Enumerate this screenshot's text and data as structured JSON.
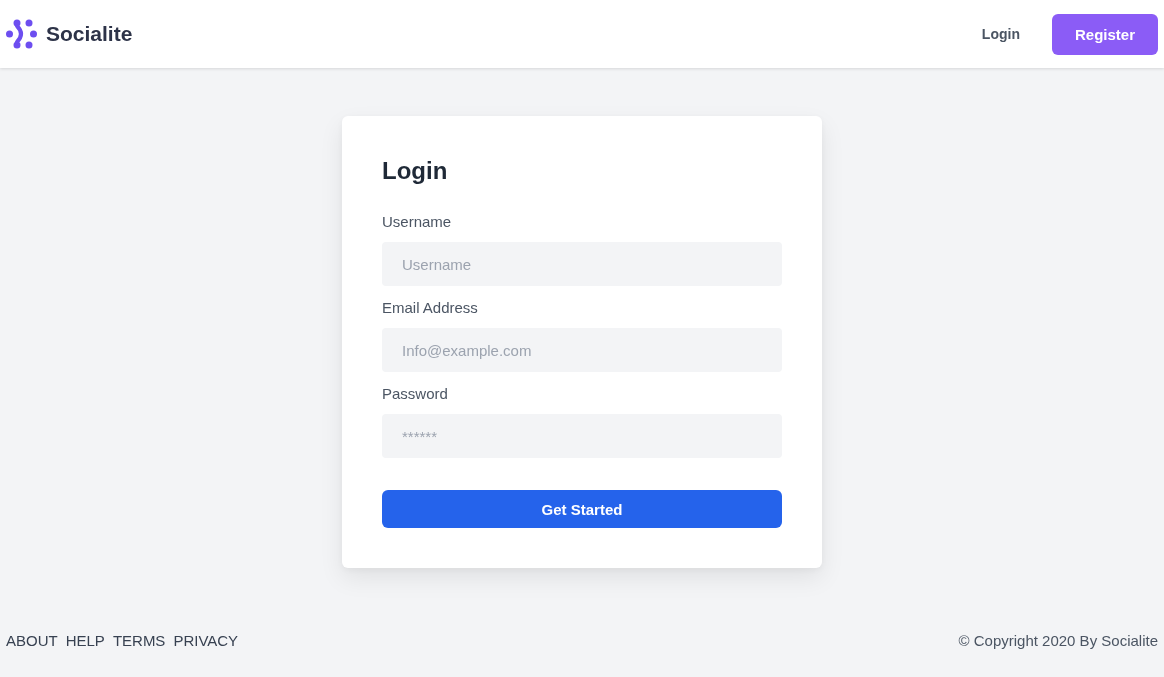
{
  "header": {
    "brand": "Socialite",
    "nav": [
      {
        "label": "Login",
        "kind": "link"
      },
      {
        "label": "Register",
        "kind": "button"
      }
    ]
  },
  "login_card": {
    "title": "Login",
    "fields": [
      {
        "label": "Username",
        "placeholder": "Username"
      },
      {
        "label": "Email Address",
        "placeholder": "Info@example.com"
      },
      {
        "label": "Password",
        "placeholder": "******"
      }
    ],
    "submit": "Get Started"
  },
  "footer": {
    "links": [
      "ABOUT",
      "HELP",
      "TERMS",
      "PRIVACY"
    ],
    "copyright": "© Copyright 2020 By Socialite"
  }
}
